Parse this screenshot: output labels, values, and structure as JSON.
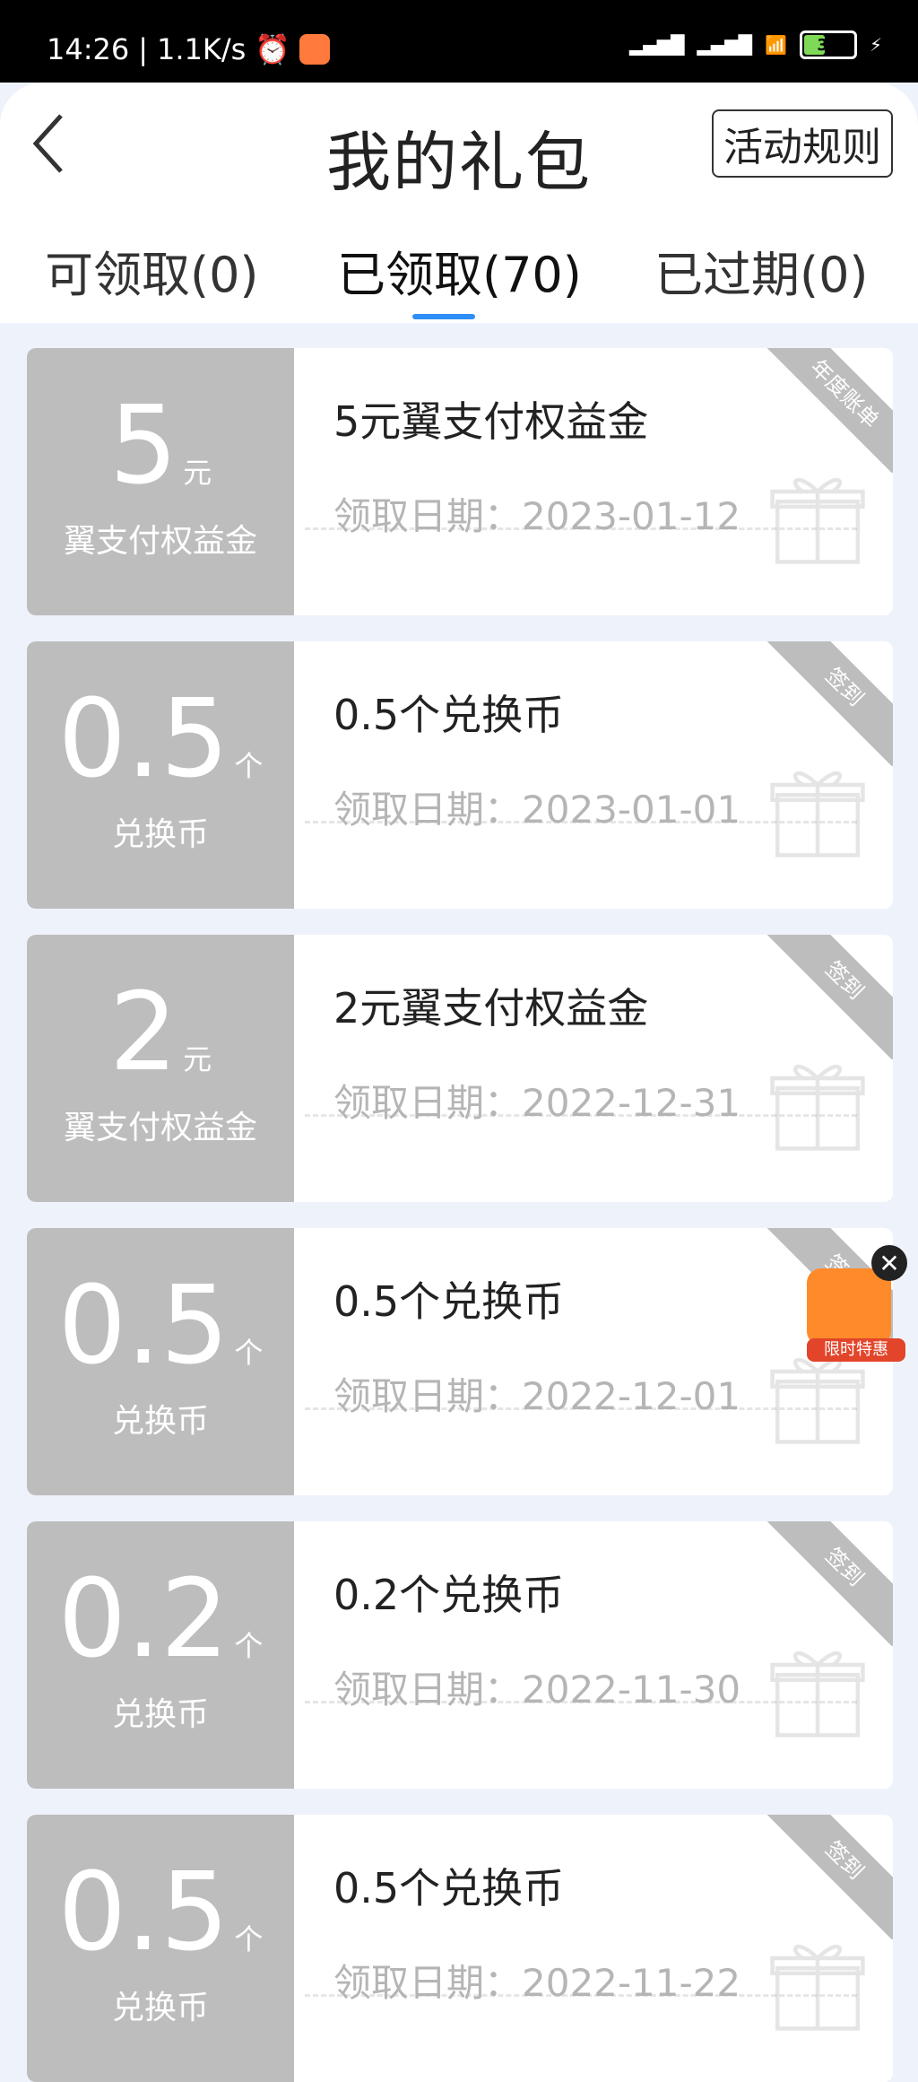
{
  "status_bar": {
    "time": "14:26",
    "speed": "1.1K/s",
    "battery": "37"
  },
  "header": {
    "title": "我的礼包",
    "rules_button": "活动规则"
  },
  "tabs": [
    {
      "label": "可领取(0)"
    },
    {
      "label": "已领取(70)"
    },
    {
      "label": "已过期(0)"
    }
  ],
  "items": [
    {
      "amount": "5",
      "unit": "元",
      "category": "翼支付权益金",
      "title": "5元翼支付权益金",
      "date": "领取日期：2023-01-12",
      "tag": "年度账单"
    },
    {
      "amount": "0.5",
      "unit": "个",
      "category": "兑换币",
      "title": "0.5个兑换币",
      "date": "领取日期：2023-01-01",
      "tag": "签到"
    },
    {
      "amount": "2",
      "unit": "元",
      "category": "翼支付权益金",
      "title": "2元翼支付权益金",
      "date": "领取日期：2022-12-31",
      "tag": "签到"
    },
    {
      "amount": "0.5",
      "unit": "个",
      "category": "兑换币",
      "title": "0.5个兑换币",
      "date": "领取日期：2022-12-01",
      "tag": "签到"
    },
    {
      "amount": "0.2",
      "unit": "个",
      "category": "兑换币",
      "title": "0.2个兑换币",
      "date": "领取日期：2022-11-30",
      "tag": "签到"
    },
    {
      "amount": "0.5",
      "unit": "个",
      "category": "兑换币",
      "title": "0.5个兑换币",
      "date": "领取日期：2022-11-22",
      "tag": "签到"
    }
  ],
  "promo": {
    "label": "限时特惠",
    "close": "✕"
  }
}
